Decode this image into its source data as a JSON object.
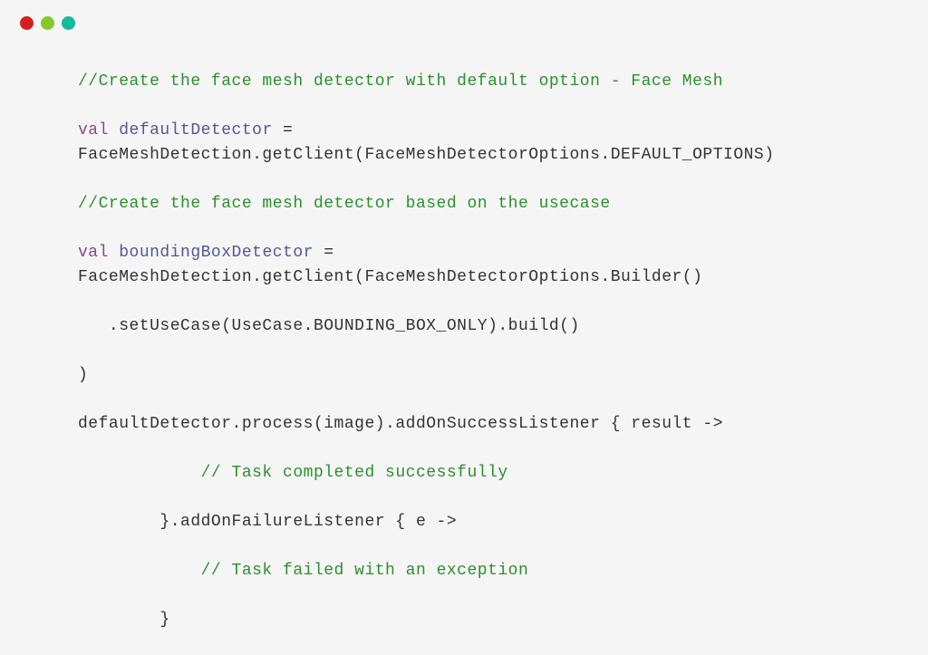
{
  "window": {
    "traffic_lights": [
      "red",
      "yellow",
      "green"
    ]
  },
  "code": {
    "line1_comment": "//Create the face mesh detector with default option - Face Mesh",
    "line2_keyword": "val",
    "line2_space": " ",
    "line2_identifier": "defaultDetector",
    "line2_rest": " =",
    "line3": "FaceMeshDetection.getClient(FaceMeshDetectorOptions.DEFAULT_OPTIONS)",
    "line4_comment": "//Create the face mesh detector based on the usecase",
    "line5_keyword": "val",
    "line5_space": " ",
    "line5_identifier": "boundingBoxDetector",
    "line5_rest": " =",
    "line6": "FaceMeshDetection.getClient(FaceMeshDetectorOptions.Builder()",
    "line7": "   .setUseCase(UseCase.BOUNDING_BOX_ONLY).build()",
    "line8": ")",
    "line9": "defaultDetector.process(image).addOnSuccessListener { result ->",
    "line10_indent": "            ",
    "line10_comment": "// Task completed successfully",
    "line11": "        }.addOnFailureListener { e ->",
    "line12_indent": "            ",
    "line12_comment": "// Task failed with an exception",
    "line13": "        }"
  }
}
